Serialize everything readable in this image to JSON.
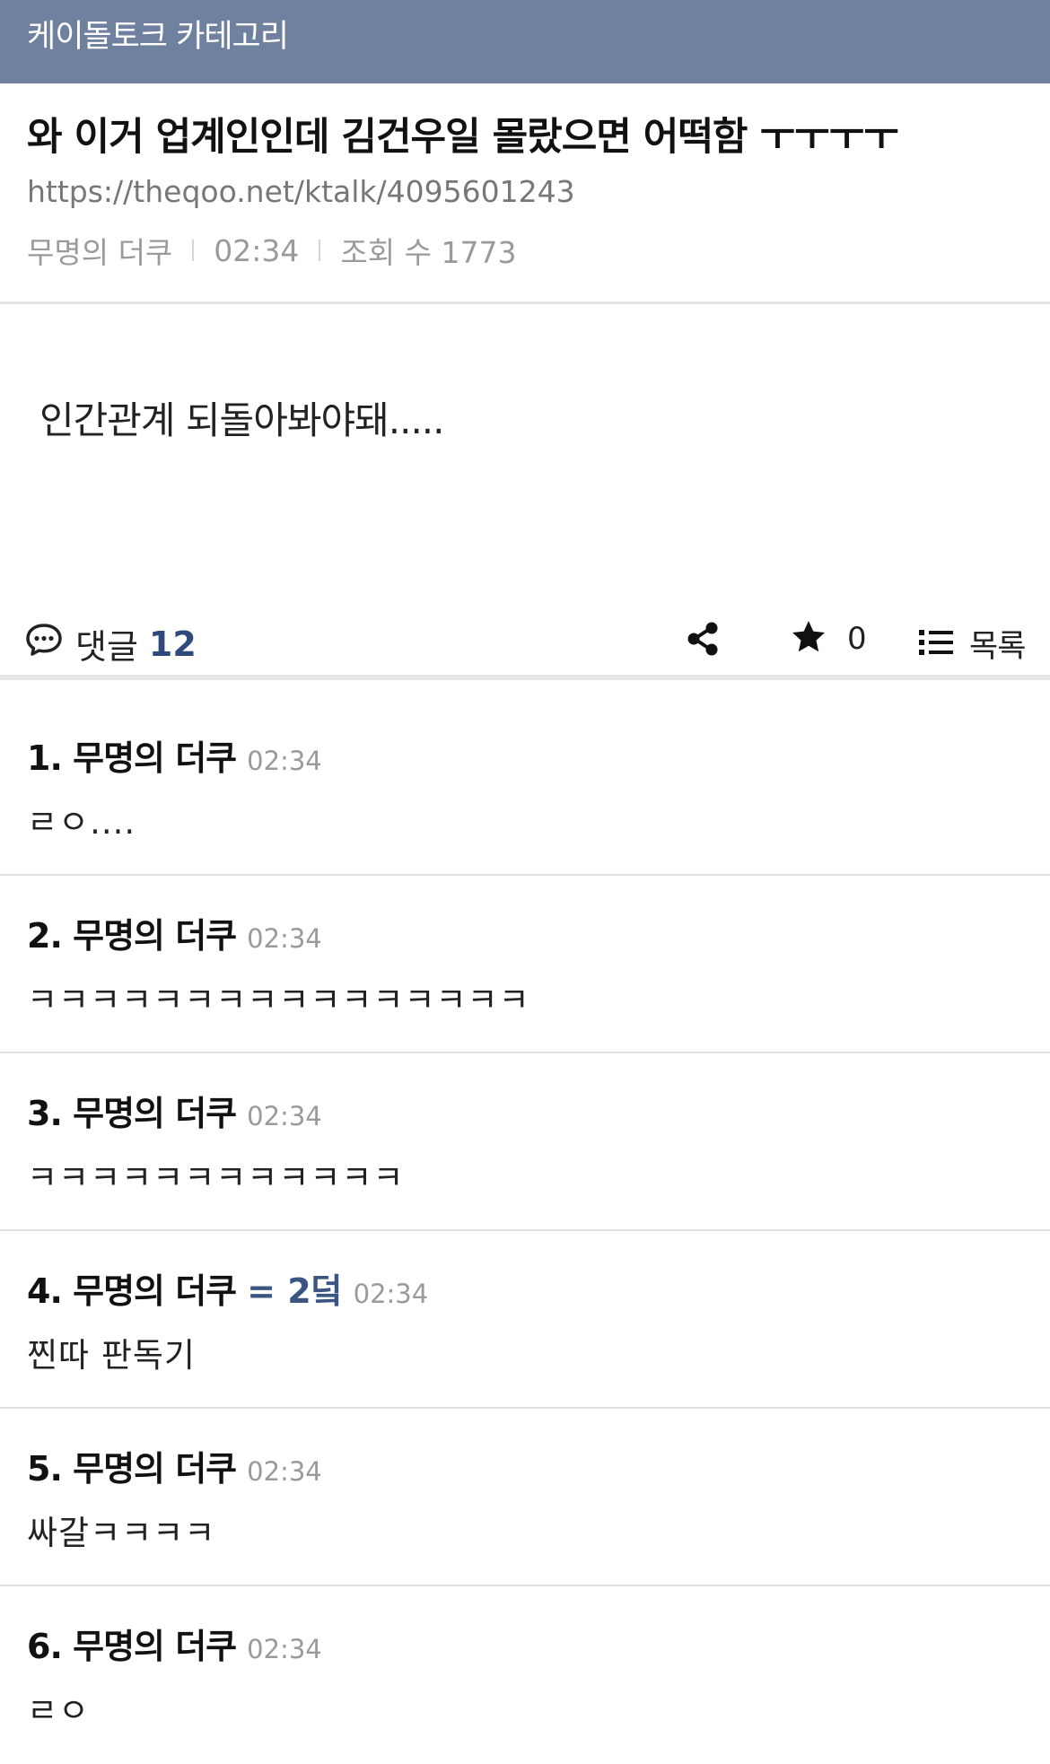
{
  "category_bar": {
    "label": "케이돌토크 카테고리",
    "color": "#6f819f"
  },
  "post": {
    "title": "와 이거 업계인인데 김건우일 몰랐으면 어떡함 ㅜㅜㅜㅜ",
    "url": "https://theqoo.net/ktalk/4095601243",
    "author": "무명의 더쿠",
    "time": "02:34",
    "views_label": "조회 수 1773",
    "body": "인간관계 되돌아봐야돼....."
  },
  "actions": {
    "comments_label": "댓글",
    "comments_count": "12",
    "share_icon": "share-icon",
    "star_icon": "star-icon",
    "star_count": "0",
    "list_icon": "list-icon",
    "list_label": "목록"
  },
  "comments": [
    {
      "name": "1. 무명의 더쿠",
      "dup": "",
      "time": "02:34",
      "text": "ㄹㅇ...."
    },
    {
      "name": "2. 무명의 더쿠",
      "dup": "",
      "time": "02:34",
      "text": "ㅋㅋㅋㅋㅋㅋㅋㅋㅋㅋㅋㅋㅋㅋㅋㅋ"
    },
    {
      "name": "3. 무명의 더쿠",
      "dup": "",
      "time": "02:34",
      "text": "ㅋㅋㅋㅋㅋㅋㅋㅋㅋㅋㅋㅋ"
    },
    {
      "name": "4. 무명의 더쿠",
      "dup": "= 2덬",
      "time": "02:34",
      "text": "찐따 판독기"
    },
    {
      "name": "5. 무명의 더쿠",
      "dup": "",
      "time": "02:34",
      "text": "싸갈ㅋㅋㅋㅋ"
    },
    {
      "name": "6. 무명의 더쿠",
      "dup": "",
      "time": "02:34",
      "text": "ㄹㅇ"
    }
  ]
}
